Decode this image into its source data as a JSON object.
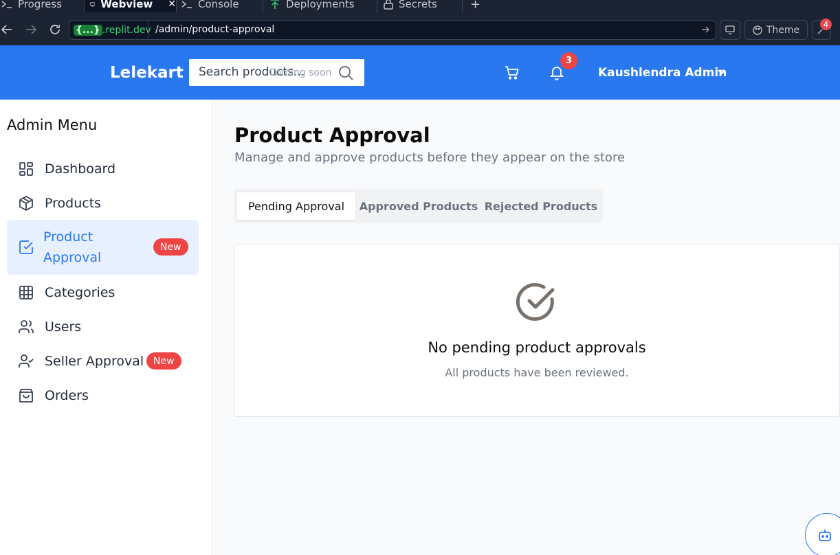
{
  "ide": {
    "tabs": [
      {
        "label": "Progress"
      },
      {
        "label": "Webview"
      },
      {
        "label": "Console"
      },
      {
        "label": "Deployments"
      },
      {
        "label": "Secrets"
      }
    ],
    "url_host_prefix": "{...}",
    "url_host": ".replit.dev",
    "url_path": "/admin/product-approval",
    "theme_label": "Theme",
    "badge_count": "4"
  },
  "header": {
    "logo": "Lelekart",
    "search_placeholder": "Search products...",
    "coming_soon": "Coming soon",
    "notification_count": "3",
    "user_name": "Kaushlendra Admin",
    "brand_color": "#2a78f0"
  },
  "sidebar": {
    "title": "Admin Menu",
    "items": [
      {
        "label": "Dashboard",
        "icon": "dashboard-icon"
      },
      {
        "label": "Products",
        "icon": "box-icon"
      },
      {
        "label": "Product Approval",
        "icon": "checkbox-icon",
        "badge": "New",
        "active": true
      },
      {
        "label": "Categories",
        "icon": "grid-icon"
      },
      {
        "label": "Users",
        "icon": "users-icon"
      },
      {
        "label": "Seller Approval",
        "icon": "user-check-icon",
        "badge": "New"
      },
      {
        "label": "Orders",
        "icon": "shopping-bag-icon"
      }
    ]
  },
  "main": {
    "title": "Product Approval",
    "subtitle": "Manage and approve products before they appear on the store",
    "tabs": [
      {
        "label": "Pending Approval",
        "active": true
      },
      {
        "label": "Approved Products"
      },
      {
        "label": "Rejected Products"
      }
    ],
    "empty_title": "No pending product approvals",
    "empty_subtitle": "All products have been reviewed."
  }
}
